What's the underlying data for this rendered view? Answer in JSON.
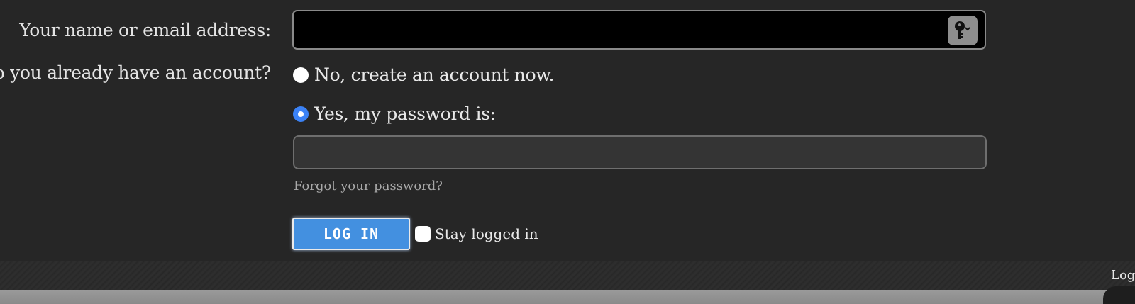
{
  "form": {
    "email_label": "Your name or email address:",
    "email_value": "",
    "account_question": "Do you already have an account?",
    "option_no": "No, create an account now.",
    "option_yes": "Yes, my password is:",
    "password_value": "",
    "forgot_link": "Forgot your password?",
    "login_button": "LOG IN",
    "stay_logged_in": "Stay logged in",
    "selected_option": "yes",
    "stay_logged_in_checked": false
  },
  "footer": {
    "log_label": "Log"
  },
  "colors": {
    "background": "#262626",
    "accent": "#3b82f6",
    "button": "#4390e0"
  },
  "icons": {
    "password_manager": "key-icon"
  }
}
